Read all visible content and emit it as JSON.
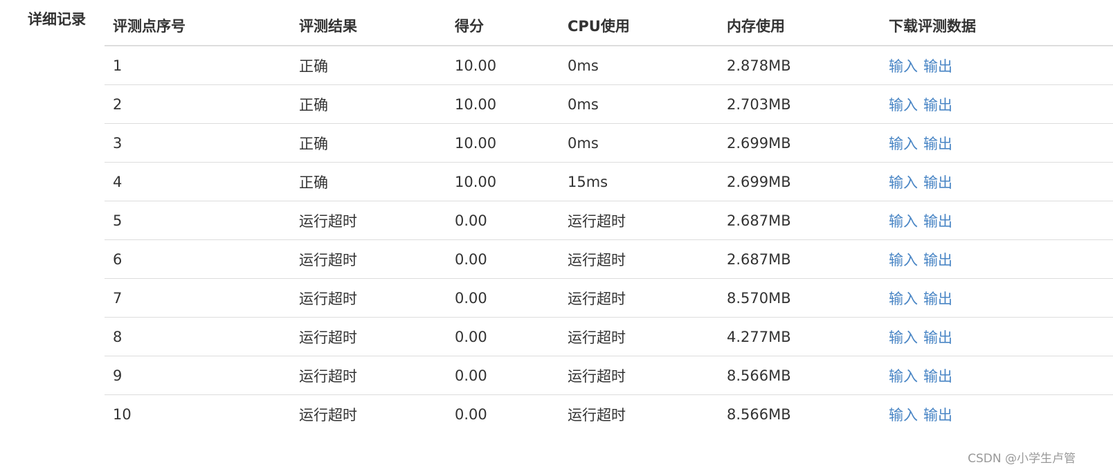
{
  "section_label": "详细记录",
  "headers": [
    "评测点序号",
    "评测结果",
    "得分",
    "CPU使用",
    "内存使用",
    "下载评测数据"
  ],
  "rows": [
    {
      "index": "1",
      "result": "正确",
      "score": "10.00",
      "cpu": "0ms",
      "memory": "2.878MB",
      "input_link": "输入",
      "output_link": "输出"
    },
    {
      "index": "2",
      "result": "正确",
      "score": "10.00",
      "cpu": "0ms",
      "memory": "2.703MB",
      "input_link": "输入",
      "output_link": "输出"
    },
    {
      "index": "3",
      "result": "正确",
      "score": "10.00",
      "cpu": "0ms",
      "memory": "2.699MB",
      "input_link": "输入",
      "output_link": "输出"
    },
    {
      "index": "4",
      "result": "正确",
      "score": "10.00",
      "cpu": "15ms",
      "memory": "2.699MB",
      "input_link": "输入",
      "output_link": "输出"
    },
    {
      "index": "5",
      "result": "运行超时",
      "score": "0.00",
      "cpu": "运行超时",
      "memory": "2.687MB",
      "input_link": "输入",
      "output_link": "输出"
    },
    {
      "index": "6",
      "result": "运行超时",
      "score": "0.00",
      "cpu": "运行超时",
      "memory": "2.687MB",
      "input_link": "输入",
      "output_link": "输出"
    },
    {
      "index": "7",
      "result": "运行超时",
      "score": "0.00",
      "cpu": "运行超时",
      "memory": "8.570MB",
      "input_link": "输入",
      "output_link": "输出"
    },
    {
      "index": "8",
      "result": "运行超时",
      "score": "0.00",
      "cpu": "运行超时",
      "memory": "4.277MB",
      "input_link": "输入",
      "output_link": "输出"
    },
    {
      "index": "9",
      "result": "运行超时",
      "score": "0.00",
      "cpu": "运行超时",
      "memory": "8.566MB",
      "input_link": "输入",
      "output_link": "输出"
    },
    {
      "index": "10",
      "result": "运行超时",
      "score": "0.00",
      "cpu": "运行超时",
      "memory": "8.566MB",
      "input_link": "输入",
      "output_link": "输出"
    }
  ],
  "watermark": "CSDN @小学生卢管",
  "colors": {
    "link": "#4a86c5",
    "text": "#333333",
    "border": "#dddddd"
  }
}
